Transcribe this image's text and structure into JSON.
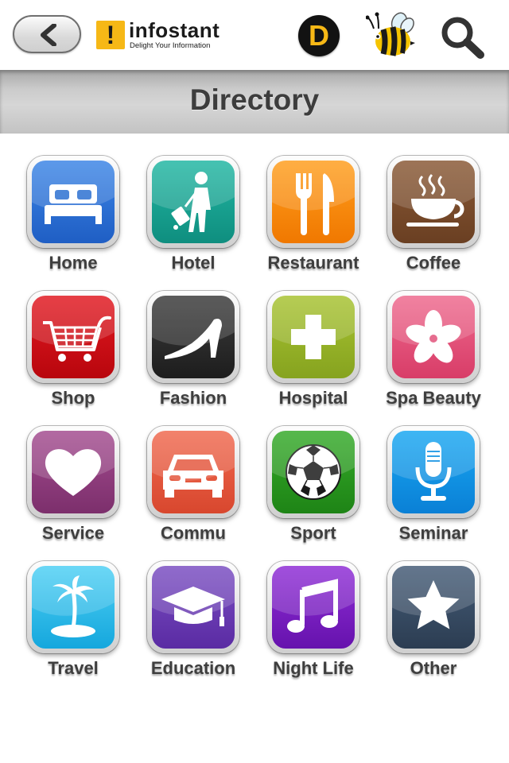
{
  "header": {
    "brand_name": "infostant",
    "brand_tagline": "Delight Your Information",
    "brand_mark": "!",
    "d_label": "D",
    "icons": [
      "back-arrow-icon",
      "bee-icon",
      "search-icon"
    ]
  },
  "title": "Directory",
  "colors": {
    "brand_yellow": "#f6b816",
    "label_text": "#3e3e3e"
  },
  "categories": [
    {
      "label": "Home",
      "icon": "bed-icon",
      "color": "#1f63c9"
    },
    {
      "label": "Hotel",
      "icon": "traveler-luggage-icon",
      "color": "#14a08f"
    },
    {
      "label": "Restaurant",
      "icon": "fork-knife-icon",
      "color": "#f7840f"
    },
    {
      "label": "Coffee",
      "icon": "coffee-cup-icon",
      "color": "#7a4b2b"
    },
    {
      "label": "Shop",
      "icon": "shopping-cart-icon",
      "color": "#cf0d15"
    },
    {
      "label": "Fashion",
      "icon": "high-heel-icon",
      "color": "#2c2c2c"
    },
    {
      "label": "Hospital",
      "icon": "plus-cross-icon",
      "color": "#97b52a"
    },
    {
      "label": "Spa Beauty",
      "icon": "flower-icon",
      "color": "#e2527a"
    },
    {
      "label": "Service",
      "icon": "heart-icon",
      "color": "#8f3d7c"
    },
    {
      "label": "Commu",
      "icon": "car-icon",
      "color": "#e4583e"
    },
    {
      "label": "Sport",
      "icon": "soccer-ball-icon",
      "color": "#2a9720"
    },
    {
      "label": "Seminar",
      "icon": "microphone-icon",
      "color": "#0c8fe3"
    },
    {
      "label": "Travel",
      "icon": "palm-island-icon",
      "color": "#1cb7e6"
    },
    {
      "label": "Education",
      "icon": "graduation-cap-icon",
      "color": "#6a37b3"
    },
    {
      "label": "Night Life",
      "icon": "music-note-icon",
      "color": "#7a1fbf"
    },
    {
      "label": "Other",
      "icon": "star-icon",
      "color": "#364b63"
    }
  ]
}
